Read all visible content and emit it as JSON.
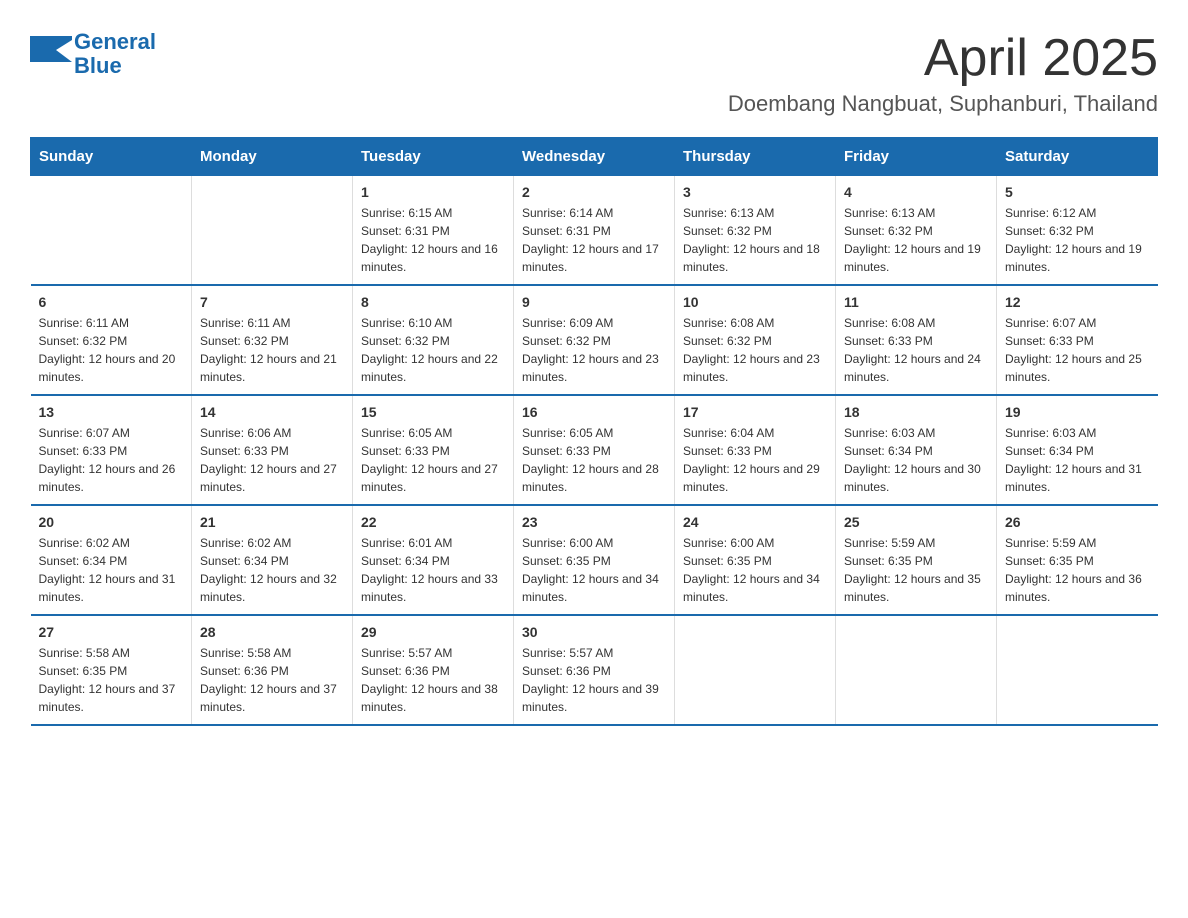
{
  "header": {
    "logo_general": "General",
    "logo_blue": "Blue",
    "month_title": "April 2025",
    "location": "Doembang Nangbuat, Suphanburi, Thailand"
  },
  "weekdays": [
    "Sunday",
    "Monday",
    "Tuesday",
    "Wednesday",
    "Thursday",
    "Friday",
    "Saturday"
  ],
  "weeks": [
    [
      {
        "day": "",
        "sunrise": "",
        "sunset": "",
        "daylight": ""
      },
      {
        "day": "",
        "sunrise": "",
        "sunset": "",
        "daylight": ""
      },
      {
        "day": "1",
        "sunrise": "Sunrise: 6:15 AM",
        "sunset": "Sunset: 6:31 PM",
        "daylight": "Daylight: 12 hours and 16 minutes."
      },
      {
        "day": "2",
        "sunrise": "Sunrise: 6:14 AM",
        "sunset": "Sunset: 6:31 PM",
        "daylight": "Daylight: 12 hours and 17 minutes."
      },
      {
        "day": "3",
        "sunrise": "Sunrise: 6:13 AM",
        "sunset": "Sunset: 6:32 PM",
        "daylight": "Daylight: 12 hours and 18 minutes."
      },
      {
        "day": "4",
        "sunrise": "Sunrise: 6:13 AM",
        "sunset": "Sunset: 6:32 PM",
        "daylight": "Daylight: 12 hours and 19 minutes."
      },
      {
        "day": "5",
        "sunrise": "Sunrise: 6:12 AM",
        "sunset": "Sunset: 6:32 PM",
        "daylight": "Daylight: 12 hours and 19 minutes."
      }
    ],
    [
      {
        "day": "6",
        "sunrise": "Sunrise: 6:11 AM",
        "sunset": "Sunset: 6:32 PM",
        "daylight": "Daylight: 12 hours and 20 minutes."
      },
      {
        "day": "7",
        "sunrise": "Sunrise: 6:11 AM",
        "sunset": "Sunset: 6:32 PM",
        "daylight": "Daylight: 12 hours and 21 minutes."
      },
      {
        "day": "8",
        "sunrise": "Sunrise: 6:10 AM",
        "sunset": "Sunset: 6:32 PM",
        "daylight": "Daylight: 12 hours and 22 minutes."
      },
      {
        "day": "9",
        "sunrise": "Sunrise: 6:09 AM",
        "sunset": "Sunset: 6:32 PM",
        "daylight": "Daylight: 12 hours and 23 minutes."
      },
      {
        "day": "10",
        "sunrise": "Sunrise: 6:08 AM",
        "sunset": "Sunset: 6:32 PM",
        "daylight": "Daylight: 12 hours and 23 minutes."
      },
      {
        "day": "11",
        "sunrise": "Sunrise: 6:08 AM",
        "sunset": "Sunset: 6:33 PM",
        "daylight": "Daylight: 12 hours and 24 minutes."
      },
      {
        "day": "12",
        "sunrise": "Sunrise: 6:07 AM",
        "sunset": "Sunset: 6:33 PM",
        "daylight": "Daylight: 12 hours and 25 minutes."
      }
    ],
    [
      {
        "day": "13",
        "sunrise": "Sunrise: 6:07 AM",
        "sunset": "Sunset: 6:33 PM",
        "daylight": "Daylight: 12 hours and 26 minutes."
      },
      {
        "day": "14",
        "sunrise": "Sunrise: 6:06 AM",
        "sunset": "Sunset: 6:33 PM",
        "daylight": "Daylight: 12 hours and 27 minutes."
      },
      {
        "day": "15",
        "sunrise": "Sunrise: 6:05 AM",
        "sunset": "Sunset: 6:33 PM",
        "daylight": "Daylight: 12 hours and 27 minutes."
      },
      {
        "day": "16",
        "sunrise": "Sunrise: 6:05 AM",
        "sunset": "Sunset: 6:33 PM",
        "daylight": "Daylight: 12 hours and 28 minutes."
      },
      {
        "day": "17",
        "sunrise": "Sunrise: 6:04 AM",
        "sunset": "Sunset: 6:33 PM",
        "daylight": "Daylight: 12 hours and 29 minutes."
      },
      {
        "day": "18",
        "sunrise": "Sunrise: 6:03 AM",
        "sunset": "Sunset: 6:34 PM",
        "daylight": "Daylight: 12 hours and 30 minutes."
      },
      {
        "day": "19",
        "sunrise": "Sunrise: 6:03 AM",
        "sunset": "Sunset: 6:34 PM",
        "daylight": "Daylight: 12 hours and 31 minutes."
      }
    ],
    [
      {
        "day": "20",
        "sunrise": "Sunrise: 6:02 AM",
        "sunset": "Sunset: 6:34 PM",
        "daylight": "Daylight: 12 hours and 31 minutes."
      },
      {
        "day": "21",
        "sunrise": "Sunrise: 6:02 AM",
        "sunset": "Sunset: 6:34 PM",
        "daylight": "Daylight: 12 hours and 32 minutes."
      },
      {
        "day": "22",
        "sunrise": "Sunrise: 6:01 AM",
        "sunset": "Sunset: 6:34 PM",
        "daylight": "Daylight: 12 hours and 33 minutes."
      },
      {
        "day": "23",
        "sunrise": "Sunrise: 6:00 AM",
        "sunset": "Sunset: 6:35 PM",
        "daylight": "Daylight: 12 hours and 34 minutes."
      },
      {
        "day": "24",
        "sunrise": "Sunrise: 6:00 AM",
        "sunset": "Sunset: 6:35 PM",
        "daylight": "Daylight: 12 hours and 34 minutes."
      },
      {
        "day": "25",
        "sunrise": "Sunrise: 5:59 AM",
        "sunset": "Sunset: 6:35 PM",
        "daylight": "Daylight: 12 hours and 35 minutes."
      },
      {
        "day": "26",
        "sunrise": "Sunrise: 5:59 AM",
        "sunset": "Sunset: 6:35 PM",
        "daylight": "Daylight: 12 hours and 36 minutes."
      }
    ],
    [
      {
        "day": "27",
        "sunrise": "Sunrise: 5:58 AM",
        "sunset": "Sunset: 6:35 PM",
        "daylight": "Daylight: 12 hours and 37 minutes."
      },
      {
        "day": "28",
        "sunrise": "Sunrise: 5:58 AM",
        "sunset": "Sunset: 6:36 PM",
        "daylight": "Daylight: 12 hours and 37 minutes."
      },
      {
        "day": "29",
        "sunrise": "Sunrise: 5:57 AM",
        "sunset": "Sunset: 6:36 PM",
        "daylight": "Daylight: 12 hours and 38 minutes."
      },
      {
        "day": "30",
        "sunrise": "Sunrise: 5:57 AM",
        "sunset": "Sunset: 6:36 PM",
        "daylight": "Daylight: 12 hours and 39 minutes."
      },
      {
        "day": "",
        "sunrise": "",
        "sunset": "",
        "daylight": ""
      },
      {
        "day": "",
        "sunrise": "",
        "sunset": "",
        "daylight": ""
      },
      {
        "day": "",
        "sunrise": "",
        "sunset": "",
        "daylight": ""
      }
    ]
  ]
}
